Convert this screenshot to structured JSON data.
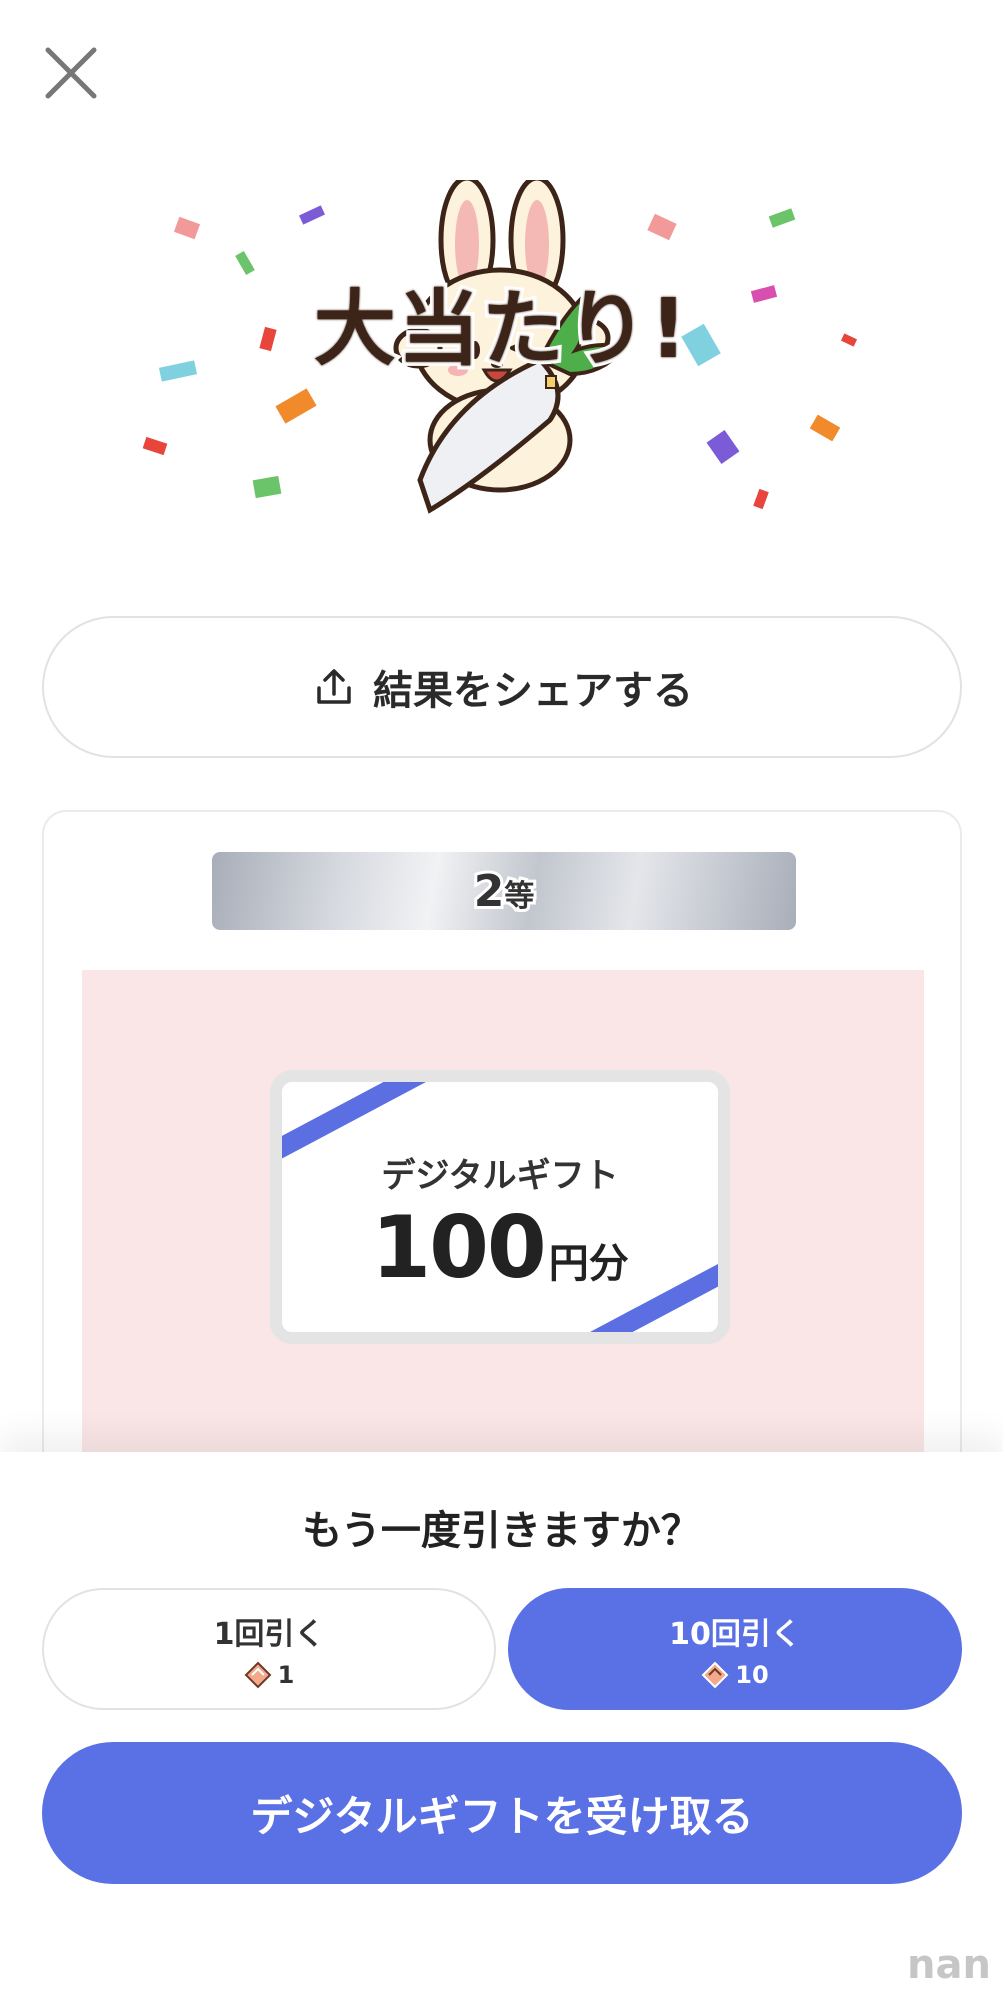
{
  "header": {
    "close_icon": "close-icon"
  },
  "hero": {
    "title": "大当たり!",
    "mascot_icon": "rabbit-with-daikon-illustration",
    "confetti_colors": [
      "#f29a9a",
      "#7b5bd6",
      "#6cc46a",
      "#e8453c",
      "#7fd1e0",
      "#f08a2a",
      "#d94fb0",
      "#e84b4b"
    ]
  },
  "share": {
    "icon": "share-icon",
    "label": "結果をシェアする"
  },
  "prize": {
    "rank_number": "2",
    "rank_suffix": "等",
    "gift_name": "デジタルギフト",
    "gift_amount": "100",
    "gift_unit": "円分",
    "stripe_color": "#5b6fe3",
    "background_color": "#fae6e7"
  },
  "draw_again": {
    "title": "もう一度引きますか？",
    "options": [
      {
        "label": "1回引く",
        "cost_icon": "ticket-icon",
        "cost": "1"
      },
      {
        "label": "10回引く",
        "cost_icon": "ticket-icon",
        "cost": "10"
      }
    ]
  },
  "receive": {
    "label": "デジタルギフトを受け取る",
    "accent_color": "#5a70e5"
  },
  "watermark": "nan"
}
